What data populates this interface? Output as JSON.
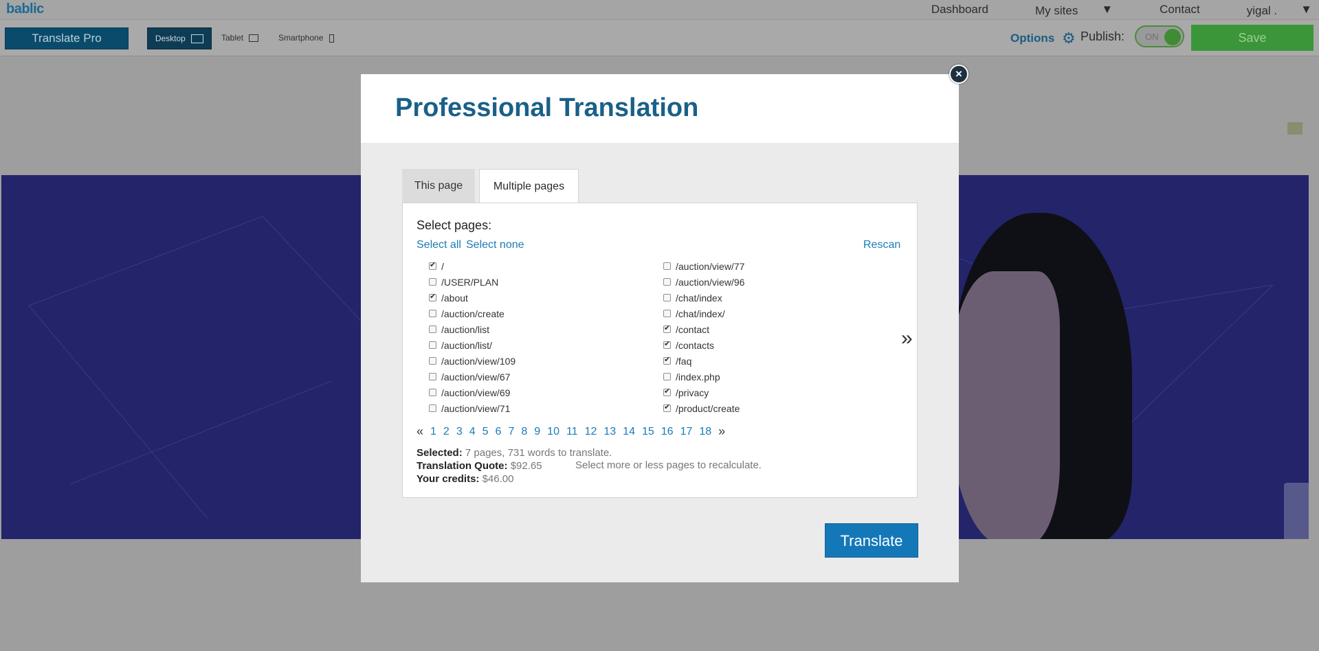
{
  "app": {
    "logo": "bablic"
  },
  "topnav": {
    "items": [
      {
        "label": "Dashboard",
        "caret": false
      },
      {
        "label": "My sites",
        "caret": true
      },
      {
        "label": "Contact",
        "caret": false
      },
      {
        "label": "yigal .",
        "caret": true
      }
    ]
  },
  "toolbar": {
    "translate_pro": "Translate Pro",
    "devices": [
      {
        "label": "Desktop",
        "icon": "monitor-icon",
        "active": true
      },
      {
        "label": "Tablet",
        "icon": "tablet-icon",
        "active": false
      },
      {
        "label": "Smartphone",
        "icon": "smartphone-icon",
        "active": false
      }
    ],
    "options_label": "Options",
    "publish_label": "Publish:",
    "publish_toggle": "ON",
    "save_label": "Save"
  },
  "modal": {
    "title": "Professional Translation",
    "close_symbol": "×",
    "tabs": [
      {
        "label": "This page",
        "active": false
      },
      {
        "label": "Multiple pages",
        "active": true
      }
    ],
    "select_pages_label": "Select pages:",
    "select_all": "Select all",
    "select_none": "Select none",
    "rescan": "Rescan",
    "pages_left": [
      {
        "path": "/",
        "checked": true
      },
      {
        "path": "/USER/PLAN",
        "checked": false
      },
      {
        "path": "/about",
        "checked": true
      },
      {
        "path": "/auction/create",
        "checked": false
      },
      {
        "path": "/auction/list",
        "checked": false
      },
      {
        "path": "/auction/list/",
        "checked": false
      },
      {
        "path": "/auction/view/109",
        "checked": false
      },
      {
        "path": "/auction/view/67",
        "checked": false
      },
      {
        "path": "/auction/view/69",
        "checked": false
      },
      {
        "path": "/auction/view/71",
        "checked": false
      }
    ],
    "pages_right": [
      {
        "path": "/auction/view/77",
        "checked": false
      },
      {
        "path": "/auction/view/96",
        "checked": false
      },
      {
        "path": "/chat/index",
        "checked": false
      },
      {
        "path": "/chat/index/",
        "checked": false
      },
      {
        "path": "/contact",
        "checked": true
      },
      {
        "path": "/contacts",
        "checked": true
      },
      {
        "path": "/faq",
        "checked": true
      },
      {
        "path": "/index.php",
        "checked": false
      },
      {
        "path": "/privacy",
        "checked": true
      },
      {
        "path": "/product/create",
        "checked": true
      }
    ],
    "next_columns": "»",
    "pager": {
      "prev": "«",
      "next": "»",
      "pages": [
        "1",
        "2",
        "3",
        "4",
        "5",
        "6",
        "7",
        "8",
        "9",
        "10",
        "11",
        "12",
        "13",
        "14",
        "15",
        "16",
        "17",
        "18"
      ]
    },
    "summary": {
      "selected_label": "Selected:",
      "selected_value": "7 pages, 731 words to translate.",
      "quote_label": "Translation Quote:",
      "quote_value": "$92.65",
      "recalc_note": "Select more or less pages to recalculate.",
      "credits_label": "Your credits:",
      "credits_value": "$46.00"
    },
    "translate_button": "Translate"
  },
  "colors": {
    "accent": "#1a6088",
    "link": "#1a7bb8",
    "button_primary": "#1478b8",
    "save_green": "#3a9638"
  }
}
